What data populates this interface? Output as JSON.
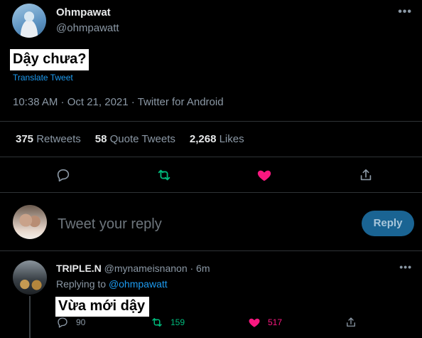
{
  "tweet": {
    "author_name": "Ohmpawat",
    "author_handle": "@ohmpawatt",
    "more_icon": "ellipsis-icon",
    "text": "Dậy chưa?",
    "translate": "Translate Tweet",
    "meta": "10:38 AM · Oct 21, 2021 · Twitter for Android"
  },
  "stats": {
    "retweets_count": "375",
    "retweets_label": "Retweets",
    "quotes_count": "58",
    "quotes_label": "Quote Tweets",
    "likes_count": "2,268",
    "likes_label": "Likes"
  },
  "actions": {
    "reply_icon": "reply-icon",
    "retweet_icon": "retweet-icon",
    "like_icon": "heart-filled-icon",
    "share_icon": "share-icon"
  },
  "composer": {
    "placeholder": "Tweet your reply",
    "button_label": "Reply"
  },
  "reply": {
    "author_name": "TRIPLE.N",
    "author_handle": "@mynameisnanon",
    "time": "· 6m",
    "replying_prefix": "Replying to",
    "replying_to": "@ohmpawatt",
    "text": "Vừa mới dậy",
    "reply_count": "90",
    "retweet_count": "159",
    "like_count": "517"
  },
  "colors": {
    "background": "#000000",
    "accent_blue": "#1d9bf0",
    "retweet_green": "#00ba7c",
    "like_pink": "#f91880",
    "muted": "#8b98a5"
  }
}
